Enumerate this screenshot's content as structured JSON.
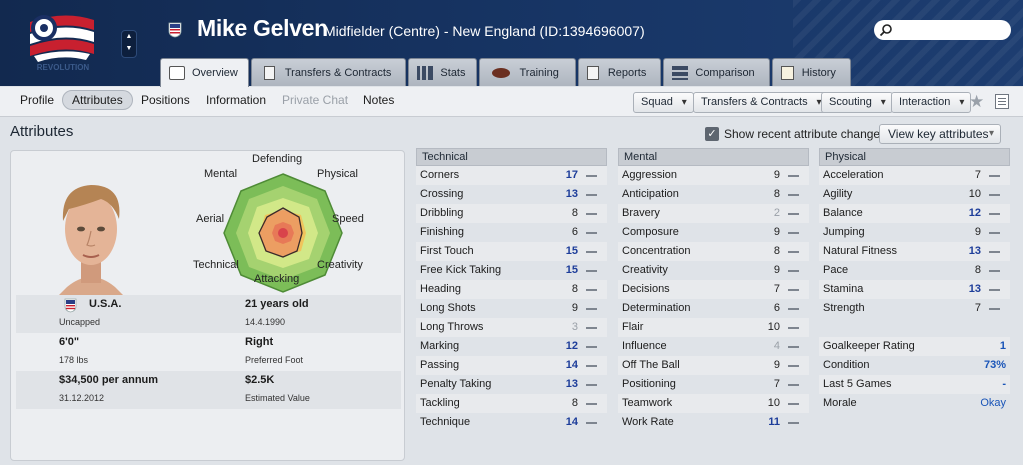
{
  "header": {
    "player_name": "Mike Gelven",
    "player_sub": "Midfielder (Centre) - New England (ID:1394696007)",
    "club_name_small": "REVOLUTION",
    "search_placeholder": ""
  },
  "tabs": [
    {
      "label": "Overview",
      "active": true
    },
    {
      "label": "Transfers & Contracts",
      "active": false
    },
    {
      "label": "Stats",
      "active": false
    },
    {
      "label": "Training",
      "active": false
    },
    {
      "label": "Reports",
      "active": false
    },
    {
      "label": "Comparison",
      "active": false
    },
    {
      "label": "History",
      "active": false
    }
  ],
  "subnav": {
    "items": [
      "Profile",
      "Attributes",
      "Positions",
      "Information",
      "Private Chat",
      "Notes"
    ],
    "active": "Attributes",
    "disabled": "Private Chat",
    "dropdowns": [
      "Squad",
      "Transfers & Contracts",
      "Scouting",
      "Interaction"
    ]
  },
  "section": {
    "title": "Attributes",
    "show_recent_label": "Show recent attribute changes",
    "show_recent_checked": true,
    "key_attributes_button": "View key attributes"
  },
  "profile": {
    "radar_labels": {
      "defending": "Defending",
      "physical": "Physical",
      "speed": "Speed",
      "creativity": "Creativity",
      "attacking": "Attacking",
      "technical": "Technical",
      "aerial": "Aerial",
      "mental": "Mental"
    },
    "nationality": "U.S.A.",
    "caps": "Uncapped",
    "age": "21 years old",
    "dob": "14.4.1990",
    "height": "6'0\"",
    "weight": "178 lbs",
    "foot": "Right",
    "foot_label": "Preferred Foot",
    "wage": "$34,500 per annum",
    "contract_end": "31.12.2012",
    "value": "$2.5K",
    "value_label": "Estimated Value"
  },
  "technical": {
    "title": "Technical",
    "rows": [
      {
        "name": "Corners",
        "value": "17",
        "level": "high"
      },
      {
        "name": "Crossing",
        "value": "13",
        "level": "high"
      },
      {
        "name": "Dribbling",
        "value": "8",
        "level": "normal"
      },
      {
        "name": "Finishing",
        "value": "6",
        "level": "normal"
      },
      {
        "name": "First Touch",
        "value": "15",
        "level": "high"
      },
      {
        "name": "Free Kick Taking",
        "value": "15",
        "level": "high"
      },
      {
        "name": "Heading",
        "value": "8",
        "level": "normal"
      },
      {
        "name": "Long Shots",
        "value": "9",
        "level": "normal"
      },
      {
        "name": "Long Throws",
        "value": "3",
        "level": "low"
      },
      {
        "name": "Marking",
        "value": "12",
        "level": "high"
      },
      {
        "name": "Passing",
        "value": "14",
        "level": "high"
      },
      {
        "name": "Penalty Taking",
        "value": "13",
        "level": "high"
      },
      {
        "name": "Tackling",
        "value": "8",
        "level": "normal"
      },
      {
        "name": "Technique",
        "value": "14",
        "level": "high"
      }
    ]
  },
  "mental": {
    "title": "Mental",
    "rows": [
      {
        "name": "Aggression",
        "value": "9",
        "level": "normal"
      },
      {
        "name": "Anticipation",
        "value": "8",
        "level": "normal"
      },
      {
        "name": "Bravery",
        "value": "2",
        "level": "low"
      },
      {
        "name": "Composure",
        "value": "9",
        "level": "normal"
      },
      {
        "name": "Concentration",
        "value": "8",
        "level": "normal"
      },
      {
        "name": "Creativity",
        "value": "9",
        "level": "normal"
      },
      {
        "name": "Decisions",
        "value": "7",
        "level": "normal"
      },
      {
        "name": "Determination",
        "value": "6",
        "level": "normal"
      },
      {
        "name": "Flair",
        "value": "10",
        "level": "normal"
      },
      {
        "name": "Influence",
        "value": "4",
        "level": "low"
      },
      {
        "name": "Off The Ball",
        "value": "9",
        "level": "normal"
      },
      {
        "name": "Positioning",
        "value": "7",
        "level": "normal"
      },
      {
        "name": "Teamwork",
        "value": "10",
        "level": "normal"
      },
      {
        "name": "Work Rate",
        "value": "11",
        "level": "high"
      }
    ]
  },
  "physical": {
    "title": "Physical",
    "rows": [
      {
        "name": "Acceleration",
        "value": "7",
        "level": "normal"
      },
      {
        "name": "Agility",
        "value": "10",
        "level": "normal"
      },
      {
        "name": "Balance",
        "value": "12",
        "level": "high"
      },
      {
        "name": "Jumping",
        "value": "9",
        "level": "normal"
      },
      {
        "name": "Natural Fitness",
        "value": "13",
        "level": "high"
      },
      {
        "name": "Pace",
        "value": "8",
        "level": "normal"
      },
      {
        "name": "Stamina",
        "value": "13",
        "level": "high"
      },
      {
        "name": "Strength",
        "value": "7",
        "level": "normal"
      }
    ],
    "extra": [
      {
        "name": "Goalkeeper Rating",
        "value": "1"
      },
      {
        "name": "Condition",
        "value": "73%"
      },
      {
        "name": "Last 5 Games",
        "value": "-"
      },
      {
        "name": "Morale",
        "value": "Okay"
      }
    ]
  },
  "colors": {
    "header_bg": "#173565",
    "high_value": "#1d3d9a",
    "low_value": "#9aa0a8",
    "link_value": "#1a55b8"
  }
}
